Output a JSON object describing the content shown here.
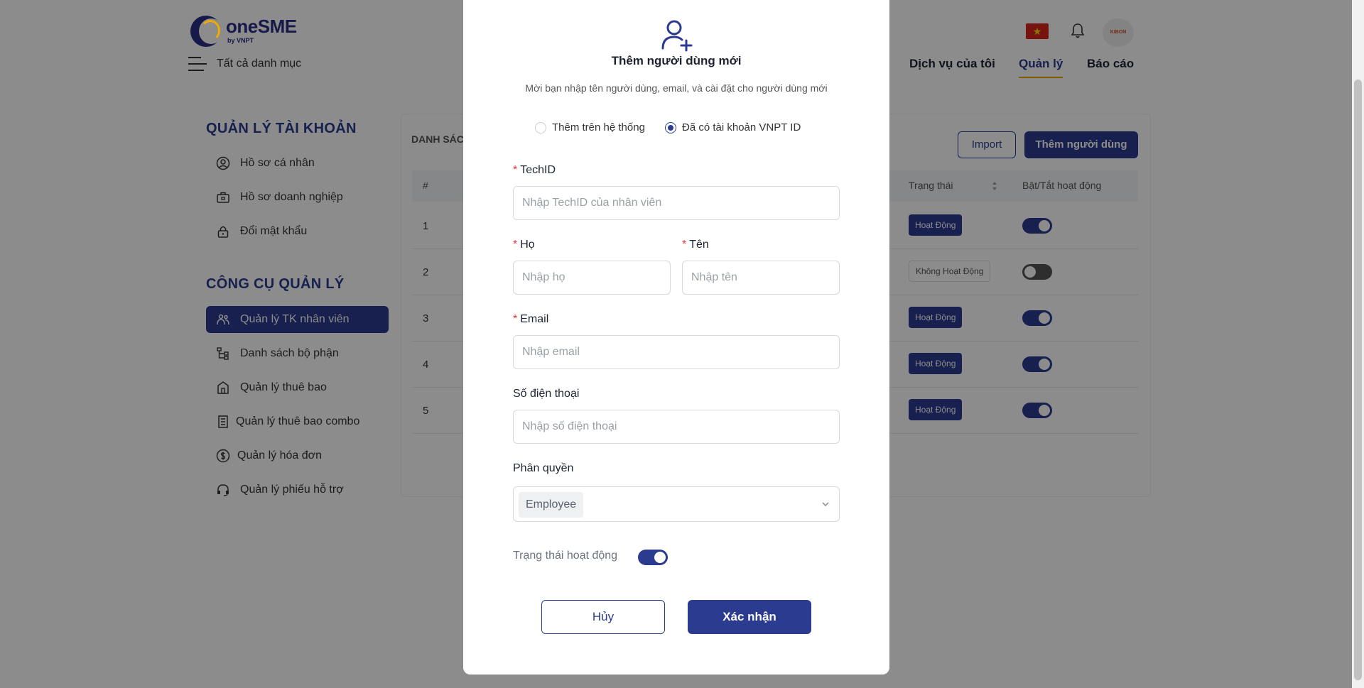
{
  "brand": {
    "name": "oneSME",
    "sub": "by VNPT"
  },
  "header": {
    "menu_label": "Tất cả danh mục",
    "nav": [
      {
        "label": "Dịch vụ của tôi"
      },
      {
        "label": "Quản lý"
      },
      {
        "label": "Báo cáo"
      }
    ],
    "flag_glyph": "★",
    "avatar_text": "KIBON"
  },
  "sidebar": {
    "section1_title": "QUẢN LÝ TÀI KHOẢN",
    "section1_items": [
      {
        "label": "Hồ sơ cá nhân",
        "icon": "user-circle-icon"
      },
      {
        "label": "Hồ sơ doanh nghiệp",
        "icon": "briefcase-icon"
      },
      {
        "label": "Đổi mật khẩu",
        "icon": "lock-icon"
      }
    ],
    "section2_title": "CÔNG CỤ QUẢN LÝ",
    "section2_items": [
      {
        "label": "Quản lý TK nhân viên",
        "icon": "users-icon",
        "active": true
      },
      {
        "label": "Danh sách bộ phận",
        "icon": "tree-icon"
      },
      {
        "label": "Quản lý thuê bao",
        "icon": "building-icon"
      },
      {
        "label": "Quản lý thuê bao combo",
        "icon": "combo-icon"
      },
      {
        "label": "Quản lý hóa đơn",
        "icon": "dollar-icon"
      },
      {
        "label": "Quản lý phiếu hỗ trợ",
        "icon": "headset-icon"
      }
    ]
  },
  "main": {
    "list_title": "DANH SÁC",
    "import_label": "Import",
    "add_label": "Thêm người dùng",
    "columns": {
      "index": "#",
      "status": "Trạng thái",
      "toggle": "Bật/Tắt hoạt động"
    },
    "rows": [
      {
        "index": "1",
        "status": "Hoạt Động",
        "active": true
      },
      {
        "index": "2",
        "status": "Không Hoạt Động",
        "active": false
      },
      {
        "index": "3",
        "status": "Hoạt Động",
        "active": true
      },
      {
        "index": "4",
        "status": "Hoạt Động",
        "active": true
      },
      {
        "index": "5",
        "status": "Hoạt Động",
        "active": true
      }
    ]
  },
  "modal": {
    "title": "Thêm người dùng mới",
    "description": "Mời bạn nhập tên người dùng, email, và cài đặt cho người dùng mới",
    "radio_system": "Thêm trên hệ thống",
    "radio_vnpt": "Đã có tài khoản VNPT ID",
    "selected_option": "Đã có tài khoản VNPT ID",
    "required_mark": "*",
    "techid_label": "TechID",
    "techid_placeholder": "Nhập TechID của nhân viên",
    "ho_label": "Họ",
    "ho_placeholder": "Nhập họ",
    "ten_label": "Tên",
    "ten_placeholder": "Nhập tên",
    "email_label": "Email",
    "email_placeholder": "Nhập email",
    "phone_label": "Số điện thoại",
    "phone_placeholder": "Nhập số điện thoại",
    "role_label": "Phân quyền",
    "role_value": "Employee",
    "status_label": "Trạng thái hoạt động",
    "status_on": true,
    "cancel_label": "Hủy",
    "confirm_label": "Xác nhận"
  },
  "colors": {
    "primary": "#2b3b8f",
    "accent": "#f2a900",
    "required": "#e53935"
  }
}
